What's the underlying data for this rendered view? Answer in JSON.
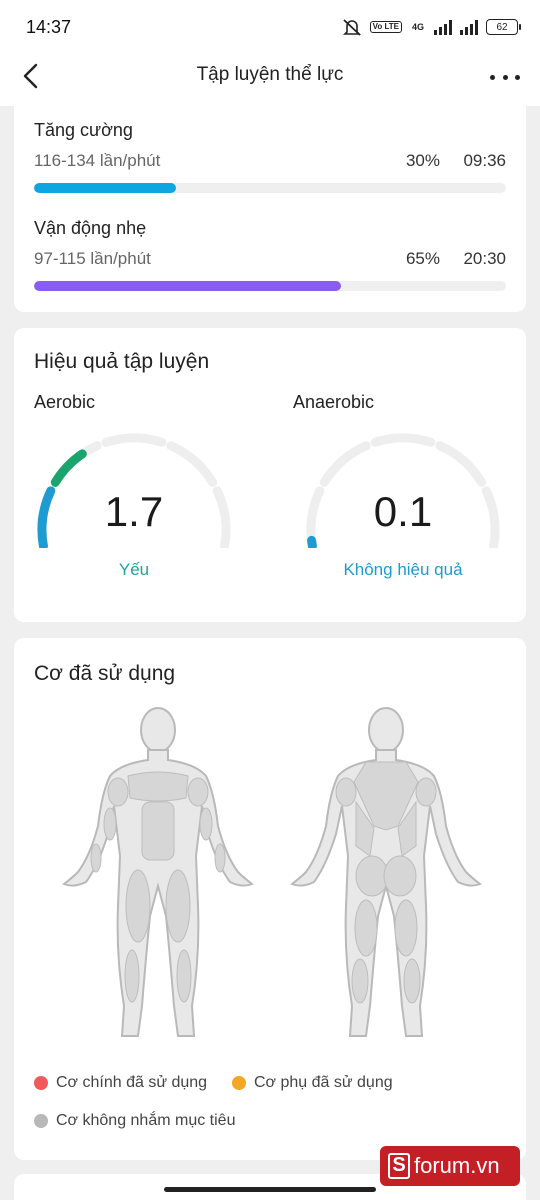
{
  "status_bar": {
    "time": "14:37",
    "network": "4G",
    "volte": "Vo LTE",
    "battery": "62",
    "icons": [
      "mute-icon",
      "volte-icon",
      "signal-icon",
      "signal-icon",
      "battery-icon"
    ]
  },
  "app_bar": {
    "title": "Tập luyện thể lực",
    "back_icon": "chevron-left-icon",
    "more_icon": "more-horizontal-icon"
  },
  "heart_zones": [
    {
      "name": "Tăng cường",
      "range": "116-134 lần/phút",
      "percent": "30%",
      "time": "09:36",
      "fill_fraction": 0.3,
      "color": "#0ea5e0"
    },
    {
      "name": "Vận động nhẹ",
      "range": "97-115 lần/phút",
      "percent": "65%",
      "time": "20:30",
      "fill_fraction": 0.65,
      "color": "#8a5cf6"
    }
  ],
  "training_effect": {
    "title": "Hiệu quả tập luyện",
    "aerobic": {
      "label": "Aerobic",
      "value": "1.7",
      "status": "Yếu",
      "status_color": "#1aa59a",
      "level": 1.7
    },
    "anaerobic": {
      "label": "Anaerobic",
      "value": "0.1",
      "status": "Không hiệu quả",
      "status_color": "#1e9bd0",
      "level": 0.1
    },
    "scale_max": 5,
    "colors": {
      "track": "#eeeeee",
      "level1": "#1e9bd0",
      "level2": "#1aa56f"
    }
  },
  "muscles": {
    "title": "Cơ đã sử dụng",
    "legend": [
      {
        "label": "Cơ chính đã sử dụng",
        "color": "#f05a5a"
      },
      {
        "label": "Cơ phụ đã sử dụng",
        "color": "#f5a623"
      },
      {
        "label": "Cơ không nhắm mục tiêu",
        "color": "#b8b8b8"
      }
    ]
  },
  "watermark": {
    "text": "forum.vn",
    "logo_letter": "S"
  }
}
